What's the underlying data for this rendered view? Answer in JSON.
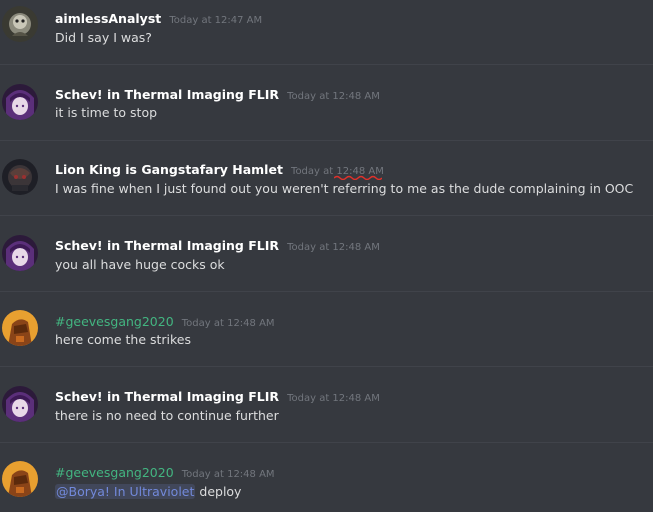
{
  "colors": {
    "background": "#36393f",
    "divider": "#40434a",
    "username_default": "#ffffff",
    "username_green": "#43b581",
    "timestamp": "#72767d",
    "message_text": "#dcddde",
    "mention_text": "#7289da",
    "spellcheck_underline": "#e0312b"
  },
  "messages": [
    {
      "avatar_icon": "aimless-analyst-avatar-icon",
      "author": "aimlessAnalyst",
      "timestamp": "Today at 12:47 AM",
      "text": "Did I say I was?"
    },
    {
      "avatar_icon": "schev-purple-avatar-icon",
      "author": "Schev! in Thermal Imaging FLIR",
      "timestamp": "Today at 12:48 AM",
      "text": "it is time to stop"
    },
    {
      "avatar_icon": "lion-king-avatar-icon",
      "author": "Lion King is Gangstafary Hamlet",
      "timestamp_prefix": "Today at ",
      "timestamp_time": "12:48 AM",
      "text": "I was fine when I just found out you weren't referring to me as the dude complaining in OOC"
    },
    {
      "avatar_icon": "schev-purple-avatar-icon",
      "author": "Schev! in Thermal Imaging FLIR",
      "timestamp": "Today at 12:48 AM",
      "text": "you all have huge cocks ok"
    },
    {
      "avatar_icon": "geeves-orange-avatar-icon",
      "author": "#geevesgang2020",
      "timestamp": "Today at 12:48 AM",
      "text": "here come the strikes"
    },
    {
      "avatar_icon": "schev-purple-avatar-icon",
      "author": "Schev! in Thermal Imaging FLIR",
      "timestamp": "Today at 12:48 AM",
      "text": "there is no need to continue further"
    },
    {
      "avatar_icon": "geeves-orange-avatar-icon",
      "author": "#geevesgang2020",
      "timestamp": "Today at 12:48 AM",
      "mention": "@Borya! In Ultraviolet",
      "text": " deploy"
    }
  ]
}
